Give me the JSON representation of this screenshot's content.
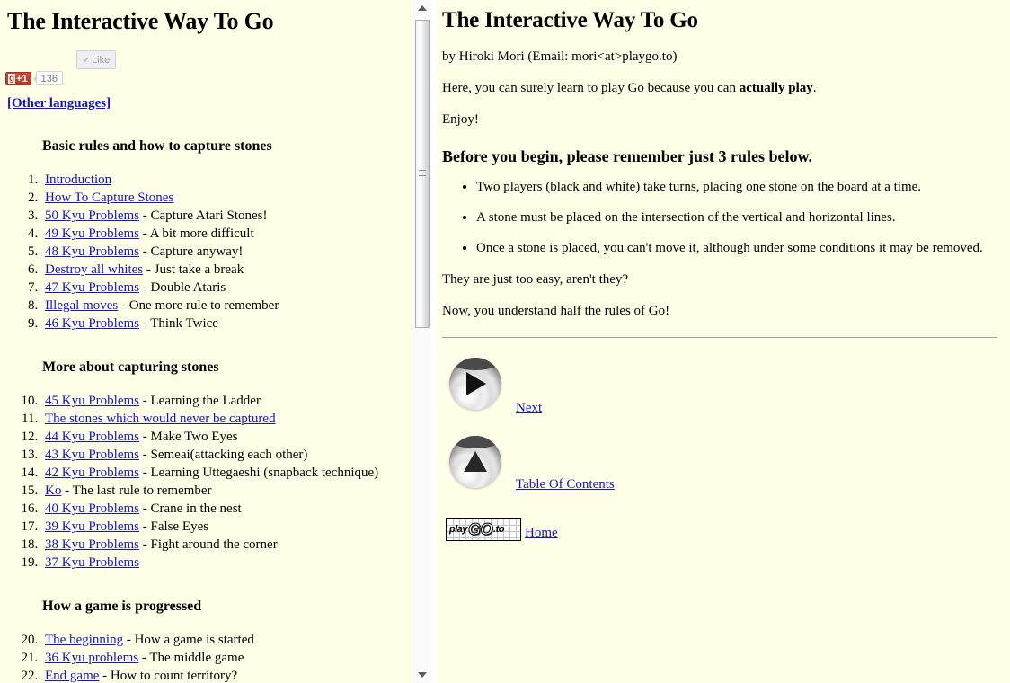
{
  "colors": {
    "page_background": "#ffffe8",
    "link": "#1414c8",
    "text": "#000000",
    "gplus_red": "#c0381f",
    "hr": "#9b9b9b"
  },
  "left_panel": {
    "title": "The Interactive Way To Go",
    "like_button": {
      "label": "Like",
      "check_glyph": "✔"
    },
    "gplus_button": {
      "g_glyph": "g",
      "label": "+1",
      "count": "136"
    },
    "other_languages_link": "[Other languages]",
    "sections": [
      {
        "heading": "Basic rules and how to capture stones",
        "start": 1,
        "items": [
          {
            "num": "1.",
            "link": "Introduction",
            "desc": ""
          },
          {
            "num": "2.",
            "link": "How To Capture Stones",
            "desc": ""
          },
          {
            "num": "3.",
            "link": "50 Kyu Problems",
            "desc": " - Capture Atari Stones!"
          },
          {
            "num": "4.",
            "link": "49 Kyu Problems",
            "desc": " - A bit more difficult"
          },
          {
            "num": "5.",
            "link": "48 Kyu Problems",
            "desc": " - Capture anyway!"
          },
          {
            "num": "6.",
            "link": "Destroy all whites",
            "desc": " - Just take a break"
          },
          {
            "num": "7.",
            "link": "47 Kyu Problems",
            "desc": " - Double Ataris"
          },
          {
            "num": "8.",
            "link": "Illegal moves",
            "desc": " - One more rule to remember"
          },
          {
            "num": "9.",
            "link": "46 Kyu Problems",
            "desc": " - Think Twice"
          }
        ]
      },
      {
        "heading": "More about capturing stones",
        "start": 10,
        "items": [
          {
            "num": "10.",
            "link": "45 Kyu Problems",
            "desc": " - Learning the Ladder"
          },
          {
            "num": "11.",
            "link": "The stones which would never be captured",
            "desc": ""
          },
          {
            "num": "12.",
            "link": "44 Kyu Problems",
            "desc": " - Make Two Eyes"
          },
          {
            "num": "13.",
            "link": "43 Kyu Problems",
            "desc": " - Semeai(attacking each other)"
          },
          {
            "num": "14.",
            "link": "42 Kyu Problems",
            "desc": " - Learning Uttegaeshi (snapback technique)"
          },
          {
            "num": "15.",
            "link": "Ko",
            "desc": " - The last rule to remember"
          },
          {
            "num": "16.",
            "link": "40 Kyu Problems",
            "desc": " - Crane in the nest"
          },
          {
            "num": "17.",
            "link": "39 Kyu Problems",
            "desc": " - False Eyes"
          },
          {
            "num": "18.",
            "link": "38 Kyu Problems",
            "desc": " - Fight around the corner"
          },
          {
            "num": "19.",
            "link": "37 Kyu Problems",
            "desc": ""
          }
        ]
      },
      {
        "heading": "How a game is progressed",
        "start": 20,
        "items": [
          {
            "num": "20.",
            "link": "The beginning",
            "desc": " - How a game is started"
          },
          {
            "num": "21.",
            "link": "36 Kyu problems",
            "desc": " - The middle game"
          },
          {
            "num": "22.",
            "link": "End game",
            "desc": " - How to count territory?"
          }
        ]
      }
    ]
  },
  "left_scrollbar": {
    "up_arrow": "▲",
    "down_arrow": "▼",
    "thumb_grip": "grip-lines"
  },
  "right_panel": {
    "title": "The Interactive Way To Go",
    "byline": "by Hiroki Mori (Email: mori<at>playgo.to)",
    "intro_prefix": "Here, you can surely learn to play Go because you can ",
    "intro_bold": "actually play",
    "intro_suffix": ".",
    "enjoy": "Enjoy!",
    "rules_heading": "Before you begin, please remember just 3 rules below.",
    "rules": [
      "Two players (black and white) take turns, placing one stone on the board at a time.",
      "A stone must be placed on the intersection of the vertical and horizontal lines.",
      "Once a stone is placed, you can't move it, although under some conditions it may be removed."
    ],
    "closing_1": "They are just too easy, aren't they?",
    "closing_2": "Now, you understand half the rules of Go!",
    "nav": {
      "next_label": "Next",
      "toc_label": "Table Of Contents",
      "home_label": "Home",
      "logo": {
        "part1": "play",
        "part2": "GO",
        "part3": ".to"
      }
    }
  }
}
